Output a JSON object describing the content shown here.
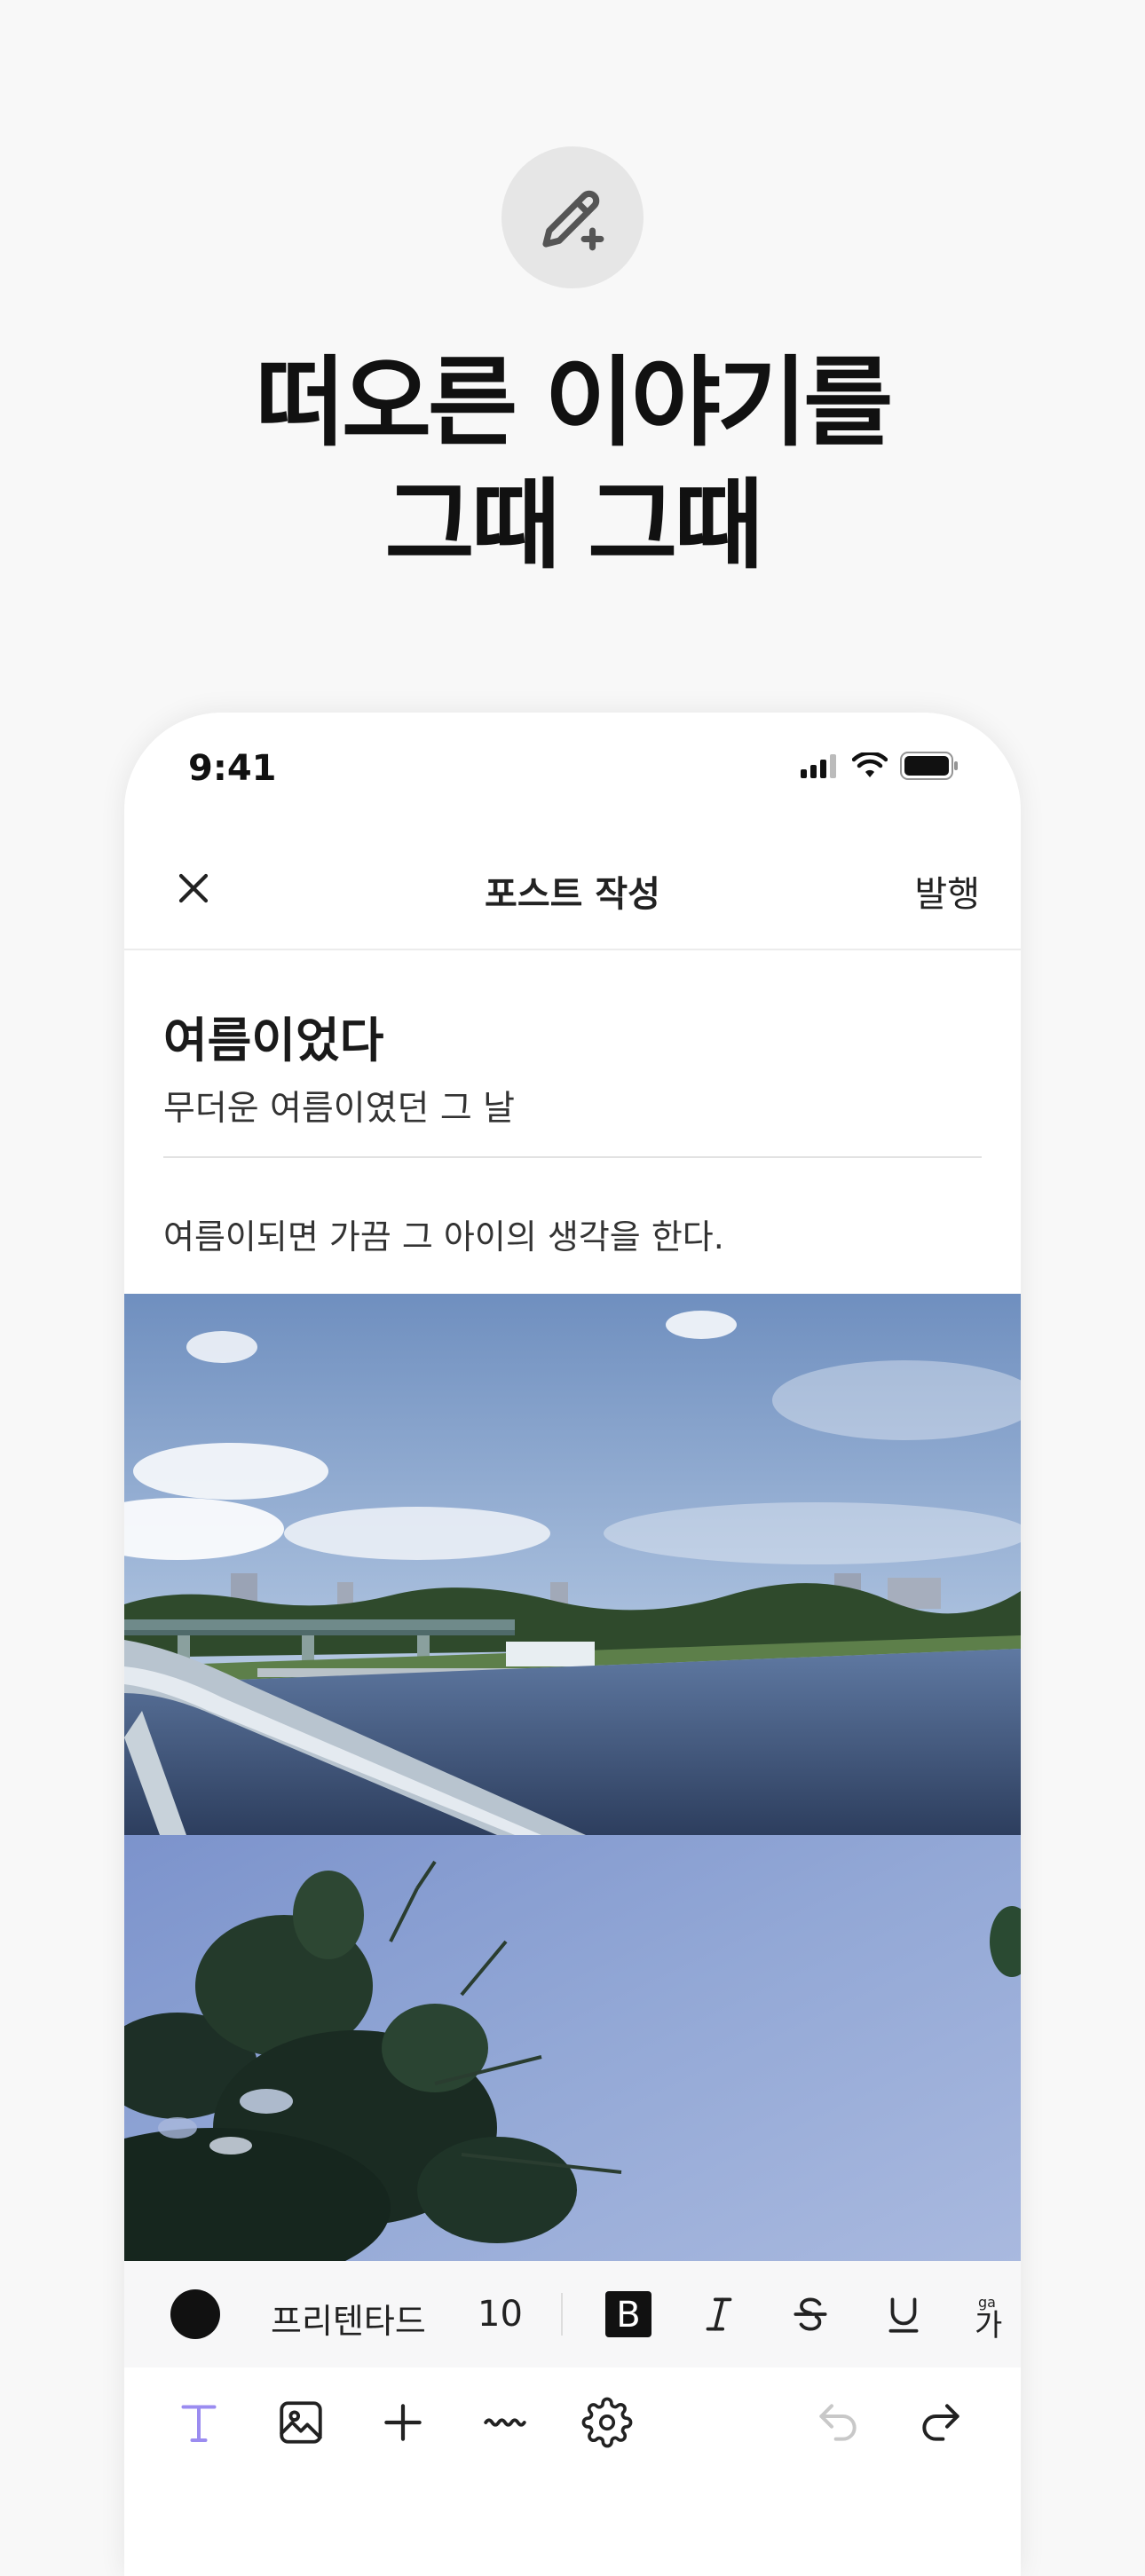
{
  "hero": {
    "icon": "pencil-plus-icon",
    "headline_line1": "떠오른 이야기를",
    "headline_line2": "그때 그때"
  },
  "status_bar": {
    "time": "9:41",
    "icons": [
      "signal-icon",
      "wifi-icon",
      "battery-icon"
    ]
  },
  "nav": {
    "close_icon": "close-icon",
    "title": "포스트 작성",
    "publish_label": "발행"
  },
  "post": {
    "title": "여름이었다",
    "subtitle": "무더운 여름이였던 그 날",
    "body": "여름이되면 가끔 그 아이의 생각을 한다."
  },
  "format_bar": {
    "text_color": "#111111",
    "font_name": "프리텐타드",
    "font_size": "10",
    "bold_icon": "bold-icon",
    "italic_icon": "italic-icon",
    "strike_icon": "strikethrough-icon",
    "underline_icon": "underline-icon",
    "ruby_icon": "ruby-icon"
  },
  "tool_bar": {
    "items": [
      "text-icon",
      "image-icon",
      "plus-icon",
      "divider-line-icon",
      "gear-icon"
    ],
    "undo_icon": "undo-icon",
    "redo_icon": "redo-icon",
    "accent": "#9b8cf0"
  }
}
